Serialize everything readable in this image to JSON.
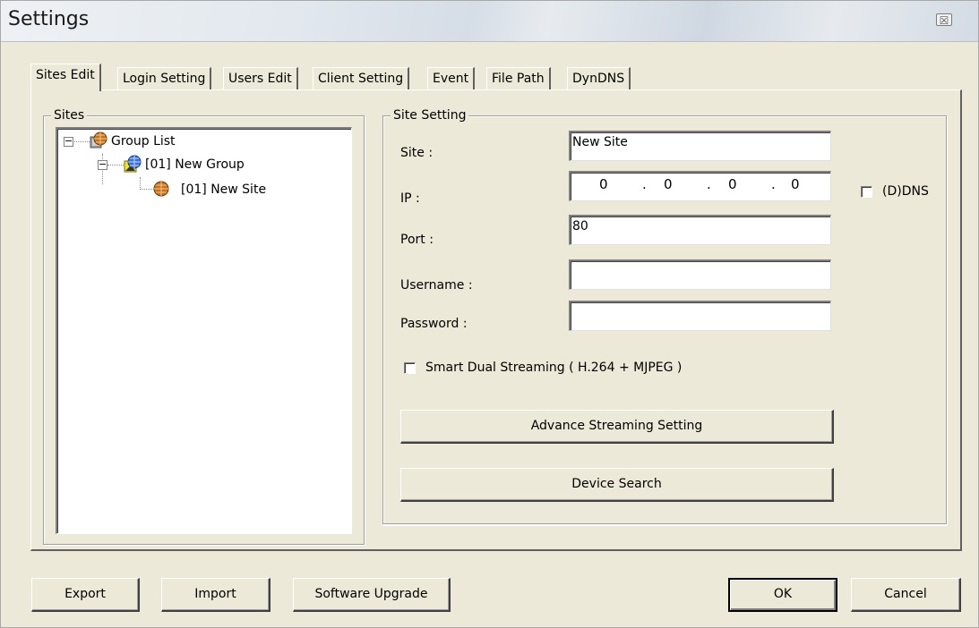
{
  "window": {
    "title": "Settings",
    "close_glyph": "☒"
  },
  "tabs": [
    {
      "label": "Sites Edit",
      "active": true
    },
    {
      "label": "Login Setting"
    },
    {
      "label": "Users Edit"
    },
    {
      "label": "Client Setting"
    },
    {
      "label": "Event"
    },
    {
      "label": "File Path"
    },
    {
      "label": "DynDNS"
    }
  ],
  "sites": {
    "legend": "Sites",
    "tree": [
      {
        "label": "Group List",
        "icon": "group-list-icon",
        "expanded": true
      },
      {
        "label": "[01] New Group",
        "icon": "globe-group-icon",
        "expanded": true
      },
      {
        "label": "[01] New Site",
        "icon": "site-icon"
      }
    ]
  },
  "site_setting": {
    "legend": "Site Setting",
    "site_label": "Site :",
    "site_value": "New Site",
    "ip_label": "IP :",
    "ip_octets": [
      "0",
      "0",
      "0",
      "0"
    ],
    "ip_sep": ".",
    "ddns_label": "(D)DNS",
    "port_label": "Port :",
    "port_value": "80",
    "username_label": "Username :",
    "username_value": "",
    "password_label": "Password :",
    "password_value": "",
    "smart_dual_label": "Smart Dual Streaming ( H.264 + MJPEG )",
    "advance_button": "Advance Streaming Setting",
    "device_search_button": "Device Search"
  },
  "footer": {
    "export": "Export",
    "import": "Import",
    "upgrade": "Software Upgrade",
    "ok": "OK",
    "cancel": "Cancel"
  }
}
